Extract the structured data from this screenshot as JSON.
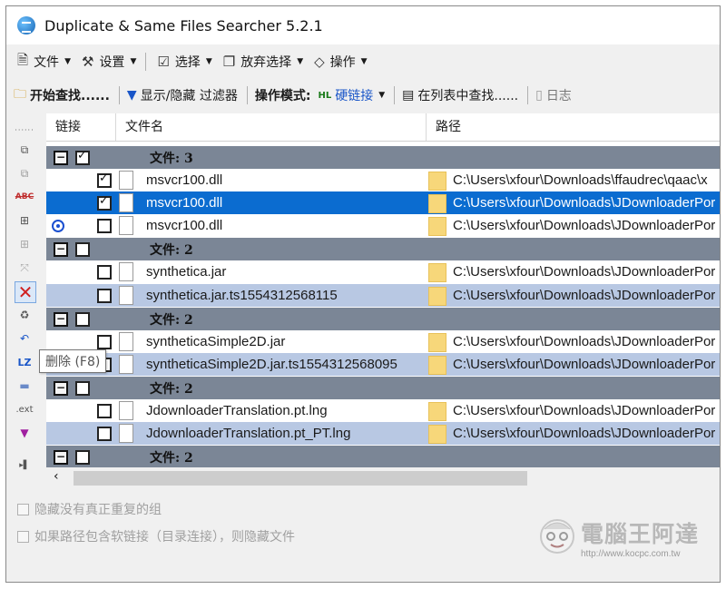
{
  "window": {
    "title": "Duplicate & Same Files Searcher 5.2.1"
  },
  "menubar": {
    "items": [
      {
        "label": "文件",
        "icon": "file-icon"
      },
      {
        "label": "设置",
        "icon": "settings-icon"
      },
      {
        "label": "选择",
        "icon": "select-icon"
      },
      {
        "label": "放弃选择",
        "icon": "deselect-icon"
      },
      {
        "label": "操作",
        "icon": "operation-icon"
      }
    ]
  },
  "toolbar": {
    "start_search": "开始查找......",
    "filter": "显示/隐藏 过滤器",
    "mode_label": "操作模式:",
    "mode_value": "硬链接",
    "find_in_list": "在列表中查找......",
    "log": "日志"
  },
  "sidebar_tooltip": "删除 (F8)",
  "grid": {
    "columns": [
      "链接",
      "文件名",
      "路径"
    ],
    "groups": [
      {
        "label": "文件: 3",
        "checked": true,
        "rows": [
          {
            "checked": true,
            "name": "msvcr100.dll",
            "path": "C:\\Users\\xfour\\Downloads\\ffaudrec\\qaac\\x",
            "style": "white",
            "link": false
          },
          {
            "checked": true,
            "name": "msvcr100.dll",
            "path": "C:\\Users\\xfour\\Downloads\\JDownloaderPor",
            "style": "selected",
            "link": false
          },
          {
            "checked": false,
            "name": "msvcr100.dll",
            "path": "C:\\Users\\xfour\\Downloads\\JDownloaderPor",
            "style": "white",
            "link": true
          }
        ]
      },
      {
        "label": "文件: 2",
        "checked": false,
        "rows": [
          {
            "checked": false,
            "name": "synthetica.jar",
            "path": "C:\\Users\\xfour\\Downloads\\JDownloaderPor",
            "style": "white",
            "link": false
          },
          {
            "checked": false,
            "name": "synthetica.jar.ts1554312568115",
            "path": "C:\\Users\\xfour\\Downloads\\JDownloaderPor",
            "style": "alt",
            "link": false
          }
        ]
      },
      {
        "label": "文件: 2",
        "checked": false,
        "rows": [
          {
            "checked": false,
            "name": "syntheticaSimple2D.jar",
            "path": "C:\\Users\\xfour\\Downloads\\JDownloaderPor",
            "style": "white",
            "link": false
          },
          {
            "checked": false,
            "name": "syntheticaSimple2D.jar.ts1554312568095",
            "path": "C:\\Users\\xfour\\Downloads\\JDownloaderPor",
            "style": "alt",
            "link": false
          }
        ]
      },
      {
        "label": "文件: 2",
        "checked": false,
        "rows": [
          {
            "checked": false,
            "name": "JdownloaderTranslation.pt.lng",
            "path": "C:\\Users\\xfour\\Downloads\\JDownloaderPor",
            "style": "white",
            "link": false
          },
          {
            "checked": false,
            "name": "JdownloaderTranslation.pt_PT.lng",
            "path": "C:\\Users\\xfour\\Downloads\\JDownloaderPor",
            "style": "alt",
            "link": false
          }
        ]
      },
      {
        "label": "文件: 2",
        "checked": false,
        "rows": []
      }
    ]
  },
  "options": [
    {
      "label": "隐藏没有真正重复的组"
    },
    {
      "label": "如果路径包含软链接（目录连接），则隐藏文件"
    }
  ],
  "watermark": {
    "title": "電腦王阿達",
    "url": "http://www.kocpc.com.tw"
  },
  "colors": {
    "group_row": "#7b8696",
    "alt_row": "#b8c8e3",
    "selected_row": "#0b6cd0"
  }
}
